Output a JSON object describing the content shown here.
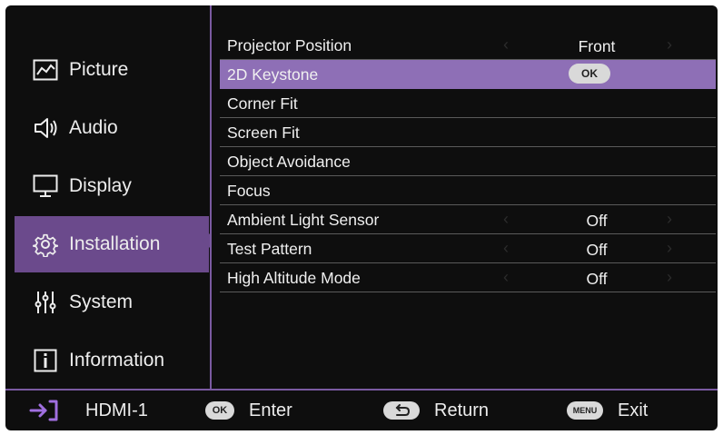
{
  "sidebar": {
    "items": [
      {
        "label": "Picture",
        "icon": "picture-icon"
      },
      {
        "label": "Audio",
        "icon": "speaker-icon"
      },
      {
        "label": "Display",
        "icon": "monitor-icon"
      },
      {
        "label": "Installation",
        "icon": "gear-icon",
        "active": true
      },
      {
        "label": "System",
        "icon": "sliders-icon"
      },
      {
        "label": "Information",
        "icon": "info-icon"
      }
    ]
  },
  "menu": {
    "rows": [
      {
        "label": "Projector Position",
        "value": "Front"
      },
      {
        "label": "2D Keystone",
        "button": "OK"
      },
      {
        "label": "Corner Fit"
      },
      {
        "label": "Screen Fit"
      },
      {
        "label": "Object Avoidance"
      },
      {
        "label": "Focus"
      },
      {
        "label": "Ambient Light Sensor",
        "value": "Off"
      },
      {
        "label": "Test Pattern",
        "value": "Off"
      },
      {
        "label": "High Altitude Mode",
        "value": "Off"
      }
    ]
  },
  "footer": {
    "source": "HDMI-1",
    "ok_key": "OK",
    "ok_action": "Enter",
    "return_action": "Return",
    "menu_key": "MENU",
    "menu_action": "Exit"
  },
  "colors": {
    "accent": "#6b4a8c",
    "highlight": "#8e6fb6",
    "background": "#0e0e0e"
  }
}
